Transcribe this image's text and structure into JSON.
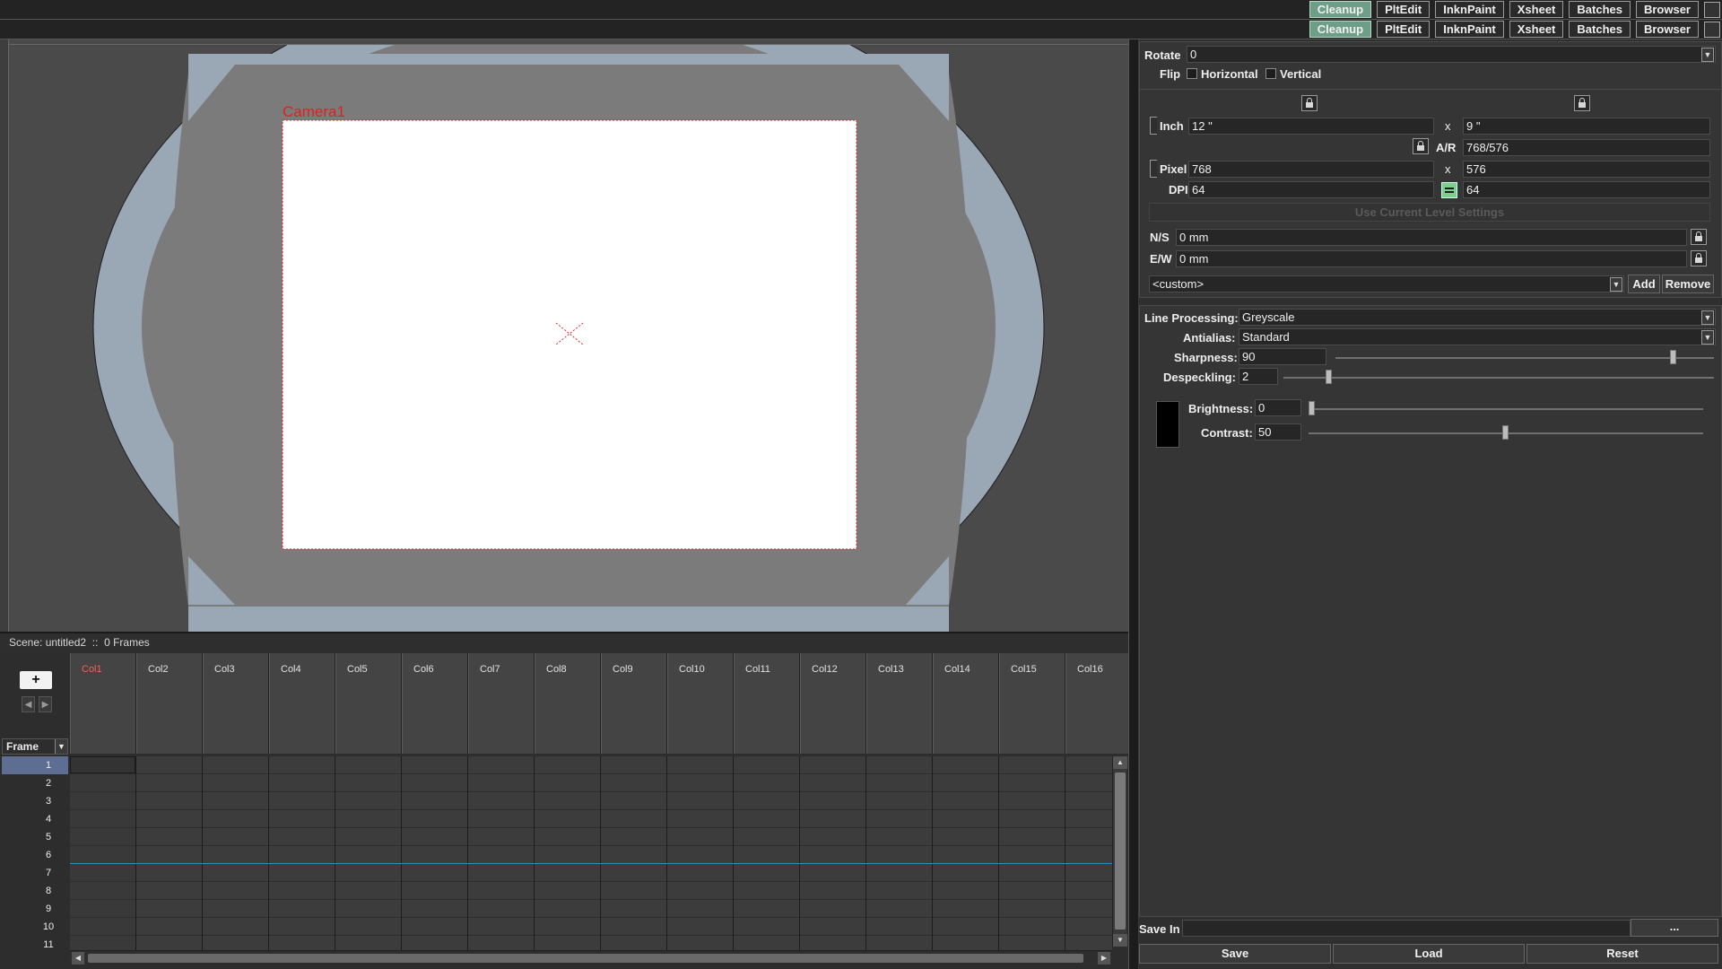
{
  "rooms": {
    "items": [
      "Cleanup",
      "PltEdit",
      "InknPaint",
      "Xsheet",
      "Batches",
      "Browser"
    ],
    "active": "Cleanup"
  },
  "viewer": {
    "camera_label": "Camera1",
    "camera_color": "#e02020"
  },
  "scene": {
    "name_label": "Scene: untitled2",
    "separator": "::",
    "frames_label": "0 Frames"
  },
  "xsheet": {
    "frame_header": "Frame",
    "new_column_label": "+",
    "columns": [
      "Col1",
      "Col2",
      "Col3",
      "Col4",
      "Col5",
      "Col6",
      "Col7",
      "Col8",
      "Col9",
      "Col10",
      "Col11",
      "Col12",
      "Col13",
      "Col14",
      "Col15",
      "Col16"
    ],
    "current_column": "Col1",
    "rows": [
      "1",
      "2",
      "3",
      "4",
      "5",
      "6",
      "7",
      "8",
      "9",
      "10",
      "11"
    ],
    "current_row": "1"
  },
  "camera_settings": {
    "rotate_label": "Rotate",
    "rotate_value": "0",
    "flip_label": "Flip",
    "flip_horizontal": "Horizontal",
    "flip_vertical": "Vertical",
    "inch_label": "Inch",
    "inch_w": "12 \"",
    "inch_h": "9 \"",
    "x_sep": "x",
    "ar_label": "A/R",
    "ar_value": "768/576",
    "pixel_label": "Pixel",
    "pixel_w": "768",
    "pixel_h": "576",
    "dpi_label": "DPI",
    "dpi_x": "64",
    "dpi_y": "64",
    "use_level_settings": "Use Current Level Settings",
    "ns_label": "N/S",
    "ns_value": "0 mm",
    "ew_label": "E/W",
    "ew_value": "0 mm",
    "preset_value": "<custom>",
    "add_label": "Add",
    "remove_label": "Remove"
  },
  "cleanup": {
    "line_processing_label": "Line Processing:",
    "line_processing_value": "Greyscale",
    "antialias_label": "Antialias:",
    "antialias_value": "Standard",
    "sharpness_label": "Sharpness:",
    "sharpness_value": "90",
    "sharpness_level": 0.9,
    "despeckling_label": "Despeckling:",
    "despeckling_value": "2",
    "despeckling_level": 0.1,
    "brightness_label": "Brightness:",
    "brightness_value": "0",
    "brightness_level": 0.0,
    "contrast_label": "Contrast:",
    "contrast_value": "50",
    "contrast_level": 0.5,
    "swatch_color": "#000000"
  },
  "footer": {
    "save_in_label": "Save In",
    "browse_label": "...",
    "save_label": "Save",
    "load_label": "Load",
    "reset_label": "Reset"
  }
}
